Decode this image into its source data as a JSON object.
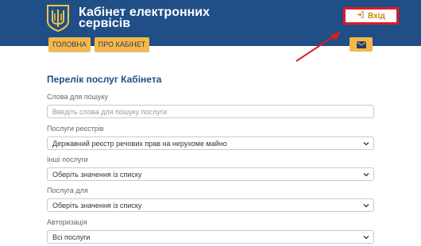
{
  "header": {
    "title_line1": "Кабінет електронних",
    "title_line2": "сервісів",
    "login_label": "Вхід",
    "brand_color": "#1f4f86"
  },
  "nav": {
    "home": "ГОЛОВНА",
    "about": "ПРО КАБІНЕТ",
    "accent_color": "#f5b847"
  },
  "main": {
    "title": "Перелік послуг Кабінета",
    "search": {
      "label": "Слова для пошуку",
      "placeholder": "Введіть слова для пошуку послуги",
      "value": ""
    },
    "registry": {
      "label": "Послуги реєстрів",
      "selected": "Державний реєстр речових прав на нерухоме майно"
    },
    "other": {
      "label": "Інші послуги",
      "selected": "Оберіть значення із списку"
    },
    "for": {
      "label": "Послуга для",
      "selected": "Оберіть значення із списку"
    },
    "auth": {
      "label": "Авторизація",
      "selected": "Всі послуги"
    }
  },
  "icons": {
    "logo": "trident-coat-of-arms-icon",
    "login": "sign-in-icon",
    "mail": "envelope-icon",
    "chevron": "chevron-down-icon",
    "annotation": "red-arrow-icon"
  }
}
